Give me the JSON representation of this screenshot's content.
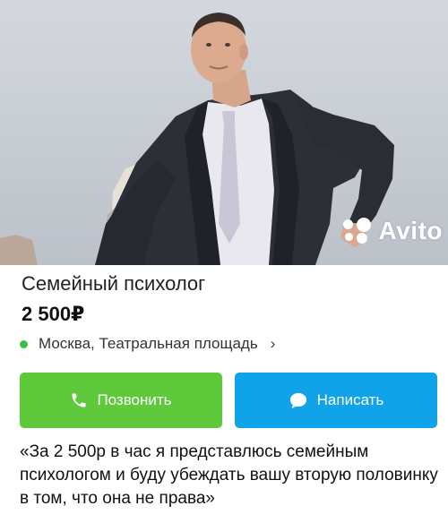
{
  "listing": {
    "title": "Семейный психолог",
    "price": "2 500₽",
    "location": "Москва, Театральная площадь",
    "location_arrow": "›",
    "call_button_label": "Позвонить",
    "message_button_label": "Написать",
    "quote": "«За 2 500р в час я представлюсь семейным психологом и буду убеждать вашу вторую половинку в том, что она не права»"
  },
  "watermark": {
    "text": "Avito"
  },
  "colors": {
    "call_button": "#5fc93c",
    "message_button": "#11a3e7",
    "location_dot": "#3cbf45"
  },
  "icons": {
    "call": "phone-icon",
    "message": "chat-bubble-icon",
    "logo": "avito-dots-icon"
  }
}
